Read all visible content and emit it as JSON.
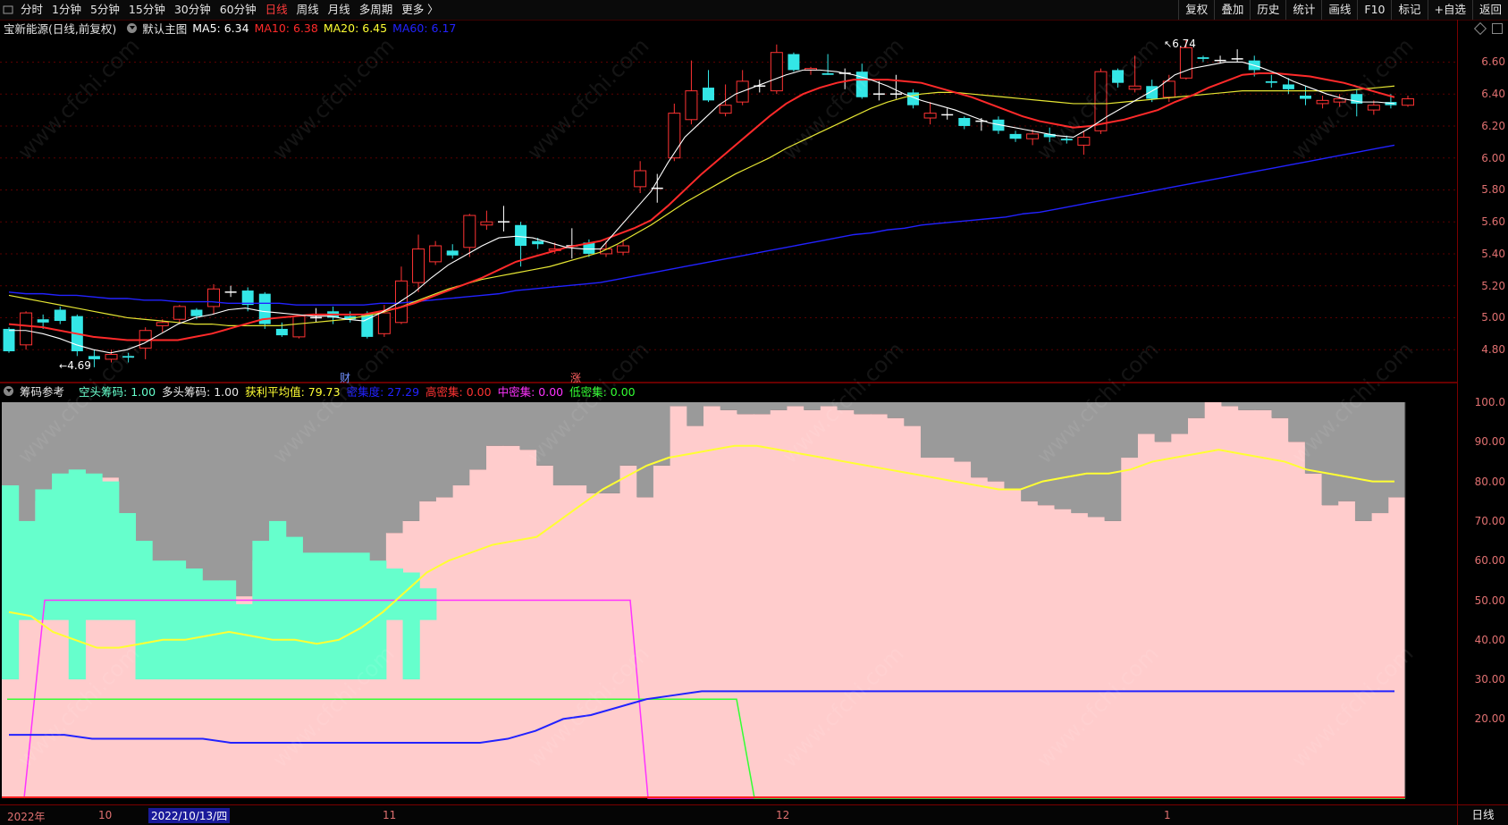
{
  "toolbar": {
    "periods": [
      "分时",
      "1分钟",
      "5分钟",
      "15分钟",
      "30分钟",
      "60分钟",
      "日线",
      "周线",
      "月线",
      "多周期",
      "更多 〉"
    ],
    "active_period": "日线",
    "right_buttons": [
      "复权",
      "叠加",
      "历史",
      "统计",
      "画线",
      "F10",
      "标记",
      "+自选",
      "返回"
    ]
  },
  "price_panel": {
    "stock_title": "宝新能源(日线,前复权)",
    "template": "默认主图",
    "ma": [
      {
        "label": "MA5: 6.34",
        "color": "#ffffff"
      },
      {
        "label": "MA10: 6.38",
        "color": "#ff2a2a"
      },
      {
        "label": "MA20: 6.45",
        "color": "#ffff33"
      },
      {
        "label": "MA60: 6.17",
        "color": "#2222ff"
      }
    ],
    "y_ticks": [
      "6.60",
      "6.40",
      "6.20",
      "6.00",
      "5.80",
      "5.60",
      "5.40",
      "5.20",
      "5.00",
      "4.80"
    ],
    "high_marker": "6.74",
    "low_marker": "4.69",
    "event_markers": [
      "财",
      "涨"
    ]
  },
  "indicator_panel": {
    "name": "筹码参考",
    "values": [
      {
        "label": "空头筹码: 1.00",
        "color": "#66ffcc"
      },
      {
        "label": "多头筹码: 1.00",
        "color": "#e6e6e6"
      },
      {
        "label": "获利平均值: 79.73",
        "color": "#ffff33"
      },
      {
        "label": "密集度: 27.29",
        "color": "#2222ff"
      },
      {
        "label": "高密集: 0.00",
        "color": "#ff3333"
      },
      {
        "label": "中密集: 0.00",
        "color": "#ff33ff"
      },
      {
        "label": "低密集: 0.00",
        "color": "#33ff33"
      }
    ],
    "y_ticks": [
      "100.0",
      "90.00",
      "80.00",
      "70.00",
      "60.00",
      "50.00",
      "40.00",
      "30.00",
      "20.00"
    ]
  },
  "date_axis": {
    "labels": [
      "2022年",
      "10",
      "11",
      "12",
      "1"
    ],
    "selected_date": "2022/10/13/四",
    "period_label": "日线"
  },
  "watermark": "www.cfchi.com",
  "colors": {
    "up": "#ff3333",
    "down": "#33e6e6",
    "bg": "#000000",
    "grid": "#5a0000"
  },
  "chart_data": {
    "type": "candlestick",
    "candles": [
      [
        4.93,
        4.79,
        4.94,
        4.78
      ],
      [
        4.83,
        5.03,
        5.04,
        4.8
      ],
      [
        4.99,
        4.97,
        5.02,
        4.93
      ],
      [
        5.05,
        4.98,
        5.07,
        4.96
      ],
      [
        5.01,
        4.79,
        5.02,
        4.76
      ],
      [
        4.76,
        4.74,
        4.8,
        4.69
      ],
      [
        4.74,
        4.77,
        4.8,
        4.72
      ],
      [
        4.76,
        4.75,
        4.78,
        4.72
      ],
      [
        4.81,
        4.92,
        4.94,
        4.74
      ],
      [
        4.95,
        4.97,
        4.99,
        4.91
      ],
      [
        4.99,
        5.07,
        5.08,
        4.97
      ],
      [
        5.05,
        5.01,
        5.06,
        4.99
      ],
      [
        5.07,
        5.18,
        5.21,
        5.02
      ],
      [
        5.16,
        5.16,
        5.2,
        5.13
      ],
      [
        5.17,
        5.08,
        5.19,
        5.04
      ],
      [
        5.15,
        4.96,
        5.16,
        4.93
      ],
      [
        4.93,
        4.89,
        4.97,
        4.88
      ],
      [
        4.88,
        5.01,
        5.02,
        4.87
      ],
      [
        5.0,
        5.0,
        5.06,
        4.97
      ],
      [
        5.04,
        5.0,
        5.07,
        4.96
      ],
      [
        5.01,
        4.99,
        5.04,
        4.97
      ],
      [
        5.02,
        4.88,
        5.04,
        4.87
      ],
      [
        4.9,
        5.03,
        5.08,
        4.88
      ],
      [
        4.97,
        5.23,
        5.32,
        4.96
      ],
      [
        5.22,
        5.43,
        5.52,
        5.16
      ],
      [
        5.35,
        5.45,
        5.48,
        5.33
      ],
      [
        5.42,
        5.39,
        5.46,
        5.37
      ],
      [
        5.44,
        5.64,
        5.65,
        5.38
      ],
      [
        5.58,
        5.6,
        5.67,
        5.55
      ],
      [
        5.6,
        5.6,
        5.7,
        5.54
      ],
      [
        5.58,
        5.45,
        5.6,
        5.32
      ],
      [
        5.48,
        5.46,
        5.5,
        5.43
      ],
      [
        5.42,
        5.43,
        5.47,
        5.4
      ],
      [
        5.45,
        5.45,
        5.56,
        5.37
      ],
      [
        5.47,
        5.4,
        5.49,
        5.38
      ],
      [
        5.4,
        5.43,
        5.48,
        5.38
      ],
      [
        5.41,
        5.45,
        5.49,
        5.39
      ],
      [
        5.82,
        5.92,
        5.98,
        5.78
      ],
      [
        5.81,
        5.81,
        5.9,
        5.72
      ],
      [
        6.0,
        6.28,
        6.34,
        5.98
      ],
      [
        6.24,
        6.42,
        6.61,
        6.21
      ],
      [
        6.44,
        6.36,
        6.55,
        6.35
      ],
      [
        6.28,
        6.33,
        6.46,
        6.26
      ],
      [
        6.35,
        6.48,
        6.55,
        6.33
      ],
      [
        6.45,
        6.45,
        6.49,
        6.41
      ],
      [
        6.42,
        6.66,
        6.71,
        6.4
      ],
      [
        6.65,
        6.55,
        6.66,
        6.54
      ],
      [
        6.55,
        6.56,
        6.57,
        6.52
      ],
      [
        6.53,
        6.52,
        6.65,
        6.52
      ],
      [
        6.53,
        6.53,
        6.56,
        6.43
      ],
      [
        6.54,
        6.38,
        6.59,
        6.37
      ],
      [
        6.4,
        6.4,
        6.48,
        6.36
      ],
      [
        6.4,
        6.4,
        6.52,
        6.37
      ],
      [
        6.41,
        6.33,
        6.43,
        6.31
      ],
      [
        6.25,
        6.28,
        6.35,
        6.21
      ],
      [
        6.27,
        6.27,
        6.31,
        6.24
      ],
      [
        6.25,
        6.2,
        6.26,
        6.18
      ],
      [
        6.23,
        6.23,
        6.25,
        6.17
      ],
      [
        6.24,
        6.17,
        6.26,
        6.15
      ],
      [
        6.15,
        6.12,
        6.17,
        6.1
      ],
      [
        6.12,
        6.15,
        6.18,
        6.08
      ],
      [
        6.15,
        6.13,
        6.19,
        6.1
      ],
      [
        6.12,
        6.11,
        6.14,
        6.09
      ],
      [
        6.08,
        6.13,
        6.17,
        6.02
      ],
      [
        6.17,
        6.54,
        6.56,
        6.15
      ],
      [
        6.55,
        6.47,
        6.56,
        6.44
      ],
      [
        6.43,
        6.45,
        6.64,
        6.41
      ],
      [
        6.45,
        6.37,
        6.49,
        6.35
      ],
      [
        6.38,
        6.48,
        6.52,
        6.35
      ],
      [
        6.5,
        6.69,
        6.74,
        6.49
      ],
      [
        6.63,
        6.62,
        6.64,
        6.6
      ],
      [
        6.61,
        6.61,
        6.64,
        6.59
      ],
      [
        6.62,
        6.62,
        6.68,
        6.6
      ],
      [
        6.61,
        6.55,
        6.64,
        6.51
      ],
      [
        6.48,
        6.47,
        6.52,
        6.44
      ],
      [
        6.46,
        6.43,
        6.5,
        6.4
      ],
      [
        6.39,
        6.37,
        6.45,
        6.33
      ],
      [
        6.34,
        6.36,
        6.39,
        6.31
      ],
      [
        6.35,
        6.37,
        6.4,
        6.32
      ],
      [
        6.4,
        6.34,
        6.43,
        6.26
      ],
      [
        6.3,
        6.33,
        6.36,
        6.27
      ],
      [
        6.35,
        6.33,
        6.4,
        6.31
      ],
      [
        6.33,
        6.37,
        6.39,
        6.32
      ]
    ],
    "ma5": [
      4.92,
      4.92,
      4.9,
      4.87,
      4.83,
      4.8,
      4.78,
      4.8,
      4.84,
      4.9,
      4.96,
      5.0,
      5.02,
      5.05,
      5.06,
      5.04,
      5.03,
      5.02,
      5.01,
      5.01,
      4.99,
      4.98,
      5.03,
      5.09,
      5.16,
      5.25,
      5.33,
      5.39,
      5.45,
      5.5,
      5.51,
      5.5,
      5.47,
      5.44,
      5.43,
      5.43,
      5.55,
      5.67,
      5.79,
      5.97,
      6.13,
      6.23,
      6.33,
      6.4,
      6.44,
      6.48,
      6.52,
      6.55,
      6.55,
      6.54,
      6.52,
      6.49,
      6.45,
      6.4,
      6.36,
      6.33,
      6.3,
      6.26,
      6.22,
      6.2,
      6.18,
      6.16,
      6.14,
      6.13,
      6.19,
      6.26,
      6.32,
      6.38,
      6.44,
      6.52,
      6.56,
      6.58,
      6.6,
      6.6,
      6.57,
      6.53,
      6.48,
      6.44,
      6.4,
      6.37,
      6.35,
      6.35,
      6.34
    ],
    "ma10": [
      4.96,
      4.95,
      4.94,
      4.92,
      4.9,
      4.88,
      4.87,
      4.86,
      4.86,
      4.86,
      4.86,
      4.88,
      4.9,
      4.93,
      4.96,
      4.99,
      5.0,
      5.01,
      5.02,
      5.02,
      5.02,
      5.02,
      5.04,
      5.06,
      5.09,
      5.13,
      5.17,
      5.21,
      5.25,
      5.3,
      5.35,
      5.38,
      5.41,
      5.44,
      5.46,
      5.48,
      5.52,
      5.56,
      5.61,
      5.7,
      5.8,
      5.9,
      5.99,
      6.08,
      6.17,
      6.26,
      6.34,
      6.4,
      6.44,
      6.47,
      6.49,
      6.49,
      6.49,
      6.48,
      6.47,
      6.44,
      6.41,
      6.38,
      6.34,
      6.3,
      6.26,
      6.23,
      6.21,
      6.19,
      6.2,
      6.22,
      6.24,
      6.27,
      6.3,
      6.35,
      6.39,
      6.44,
      6.48,
      6.52,
      6.53,
      6.53,
      6.52,
      6.51,
      6.49,
      6.47,
      6.44,
      6.41,
      6.38
    ],
    "ma20": [
      5.14,
      5.12,
      5.1,
      5.08,
      5.06,
      5.04,
      5.02,
      5.0,
      4.99,
      4.98,
      4.97,
      4.96,
      4.96,
      4.95,
      4.95,
      4.95,
      4.95,
      4.96,
      4.97,
      4.98,
      4.99,
      5.01,
      5.03,
      5.06,
      5.1,
      5.14,
      5.18,
      5.21,
      5.24,
      5.26,
      5.28,
      5.3,
      5.32,
      5.35,
      5.38,
      5.41,
      5.46,
      5.52,
      5.58,
      5.65,
      5.72,
      5.78,
      5.84,
      5.9,
      5.95,
      6.0,
      6.06,
      6.11,
      6.16,
      6.21,
      6.26,
      6.31,
      6.35,
      6.38,
      6.4,
      6.41,
      6.41,
      6.4,
      6.39,
      6.38,
      6.37,
      6.36,
      6.35,
      6.34,
      6.34,
      6.34,
      6.35,
      6.36,
      6.37,
      6.38,
      6.39,
      6.4,
      6.41,
      6.42,
      6.42,
      6.42,
      6.42,
      6.42,
      6.42,
      6.42,
      6.43,
      6.44,
      6.45
    ],
    "ma60": [
      5.16,
      5.15,
      5.15,
      5.14,
      5.14,
      5.13,
      5.12,
      5.12,
      5.11,
      5.11,
      5.1,
      5.1,
      5.1,
      5.09,
      5.09,
      5.09,
      5.09,
      5.08,
      5.08,
      5.08,
      5.08,
      5.08,
      5.09,
      5.09,
      5.1,
      5.11,
      5.12,
      5.13,
      5.14,
      5.15,
      5.17,
      5.18,
      5.19,
      5.2,
      5.21,
      5.22,
      5.24,
      5.26,
      5.28,
      5.3,
      5.32,
      5.34,
      5.36,
      5.38,
      5.4,
      5.42,
      5.44,
      5.46,
      5.48,
      5.5,
      5.52,
      5.53,
      5.55,
      5.56,
      5.58,
      5.59,
      5.6,
      5.61,
      5.62,
      5.63,
      5.65,
      5.66,
      5.68,
      5.7,
      5.72,
      5.74,
      5.76,
      5.78,
      5.8,
      5.82,
      5.84,
      5.86,
      5.88,
      5.9,
      5.92,
      5.94,
      5.96,
      5.98,
      6.0,
      6.02,
      6.04,
      6.06,
      6.08
    ],
    "profit_pct": [
      79,
      66,
      75,
      78,
      82,
      82,
      81,
      69,
      62,
      58,
      58,
      56,
      52,
      50,
      51,
      60,
      64,
      60,
      59,
      59,
      58,
      60,
      59,
      67,
      70,
      75,
      76,
      79,
      83,
      89,
      89,
      88,
      84,
      79,
      79,
      77,
      77,
      84,
      76,
      84,
      99,
      94,
      99,
      98,
      97,
      97,
      98,
      99,
      98,
      99,
      98,
      97,
      97,
      96,
      94,
      86,
      86,
      85,
      81,
      80,
      78,
      75,
      74,
      73,
      72,
      71,
      70,
      86,
      92,
      90,
      92,
      96,
      100,
      99,
      98,
      98,
      96,
      90,
      82,
      74,
      75,
      70,
      72,
      76
    ],
    "short_chips_pct": [
      79,
      70,
      78,
      82,
      83,
      82,
      80,
      72,
      65,
      60,
      60,
      58,
      55,
      55,
      49,
      65,
      70,
      66,
      62,
      62,
      62,
      62,
      60,
      58,
      57,
      53
    ],
    "profit_avg": [
      47,
      46,
      42,
      40,
      38,
      38,
      39,
      40,
      40,
      41,
      42,
      41,
      40,
      40,
      39,
      40,
      43,
      47,
      52,
      57,
      60,
      62,
      64,
      65,
      66,
      70,
      74,
      78,
      81,
      84,
      86,
      87,
      88,
      89,
      89,
      88,
      87,
      86,
      85,
      84,
      83,
      82,
      81,
      80,
      79,
      78,
      78,
      80,
      81,
      82,
      82,
      83,
      85,
      86,
      87,
      88,
      87,
      86,
      85,
      83,
      82,
      81,
      80,
      80
    ],
    "concentration": [
      16,
      16,
      16,
      15,
      15,
      15,
      15,
      15,
      14,
      14,
      14,
      14,
      14,
      14,
      14,
      14,
      14,
      14,
      15,
      17,
      20,
      21,
      23,
      25,
      26,
      27,
      27,
      27,
      27,
      27,
      27,
      27,
      27,
      27,
      27,
      27,
      27,
      27,
      27,
      27,
      27,
      27,
      27,
      27,
      27,
      27,
      27,
      27,
      27,
      27,
      27
    ],
    "mid_density_window_pct": 50,
    "low_density_window_pct": 25,
    "price_ylim": [
      4.65,
      6.72
    ],
    "indicator_ylim": [
      0,
      100
    ]
  }
}
